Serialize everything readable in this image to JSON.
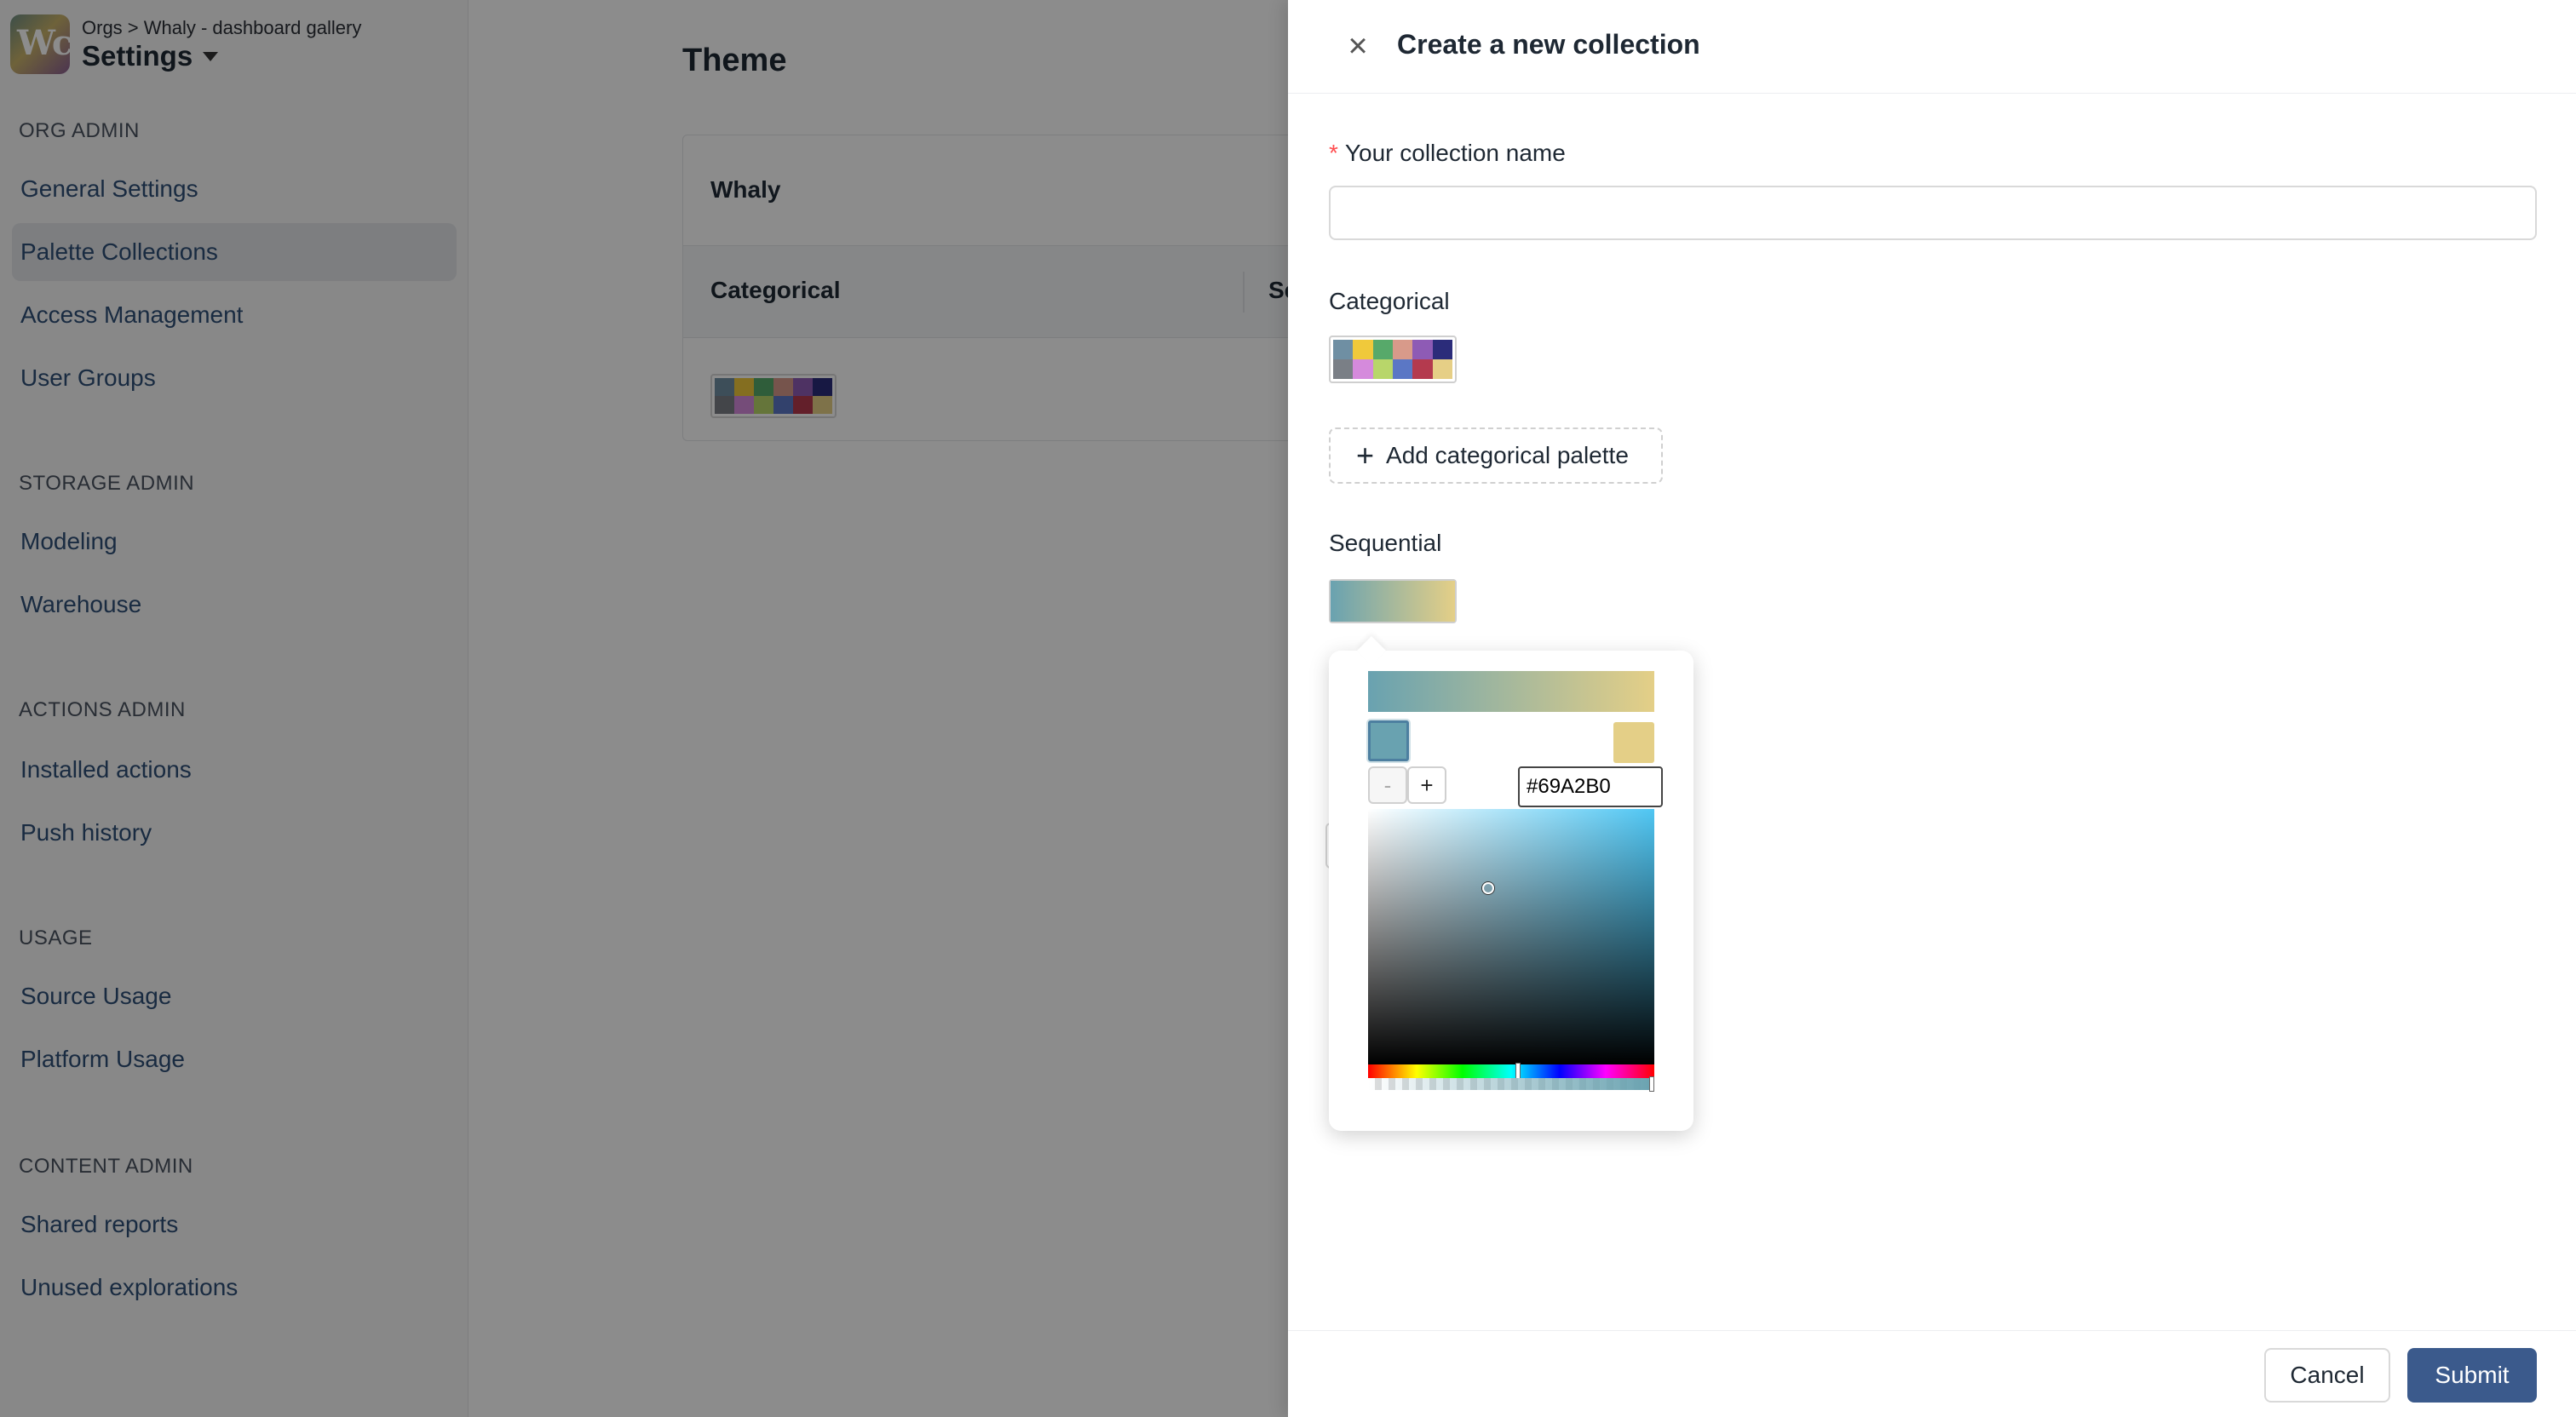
{
  "sidebar": {
    "breadcrumb": "Orgs > Whaly - dashboard gallery",
    "title": "Settings",
    "sections": [
      {
        "label": "ORG ADMIN",
        "items": [
          "General Settings",
          "Palette Collections",
          "Access Management",
          "User Groups"
        ]
      },
      {
        "label": "STORAGE ADMIN",
        "items": [
          "Modeling",
          "Warehouse"
        ]
      },
      {
        "label": "ACTIONS ADMIN",
        "items": [
          "Installed actions",
          "Push history"
        ]
      },
      {
        "label": "USAGE",
        "items": [
          "Source Usage",
          "Platform Usage"
        ]
      },
      {
        "label": "CONTENT ADMIN",
        "items": [
          "Shared reports",
          "Unused explorations"
        ]
      }
    ],
    "active_item": "Palette Collections"
  },
  "main": {
    "page_title": "Theme",
    "card_title": "Whaly",
    "columns": [
      "Categorical",
      "Se"
    ]
  },
  "drawer": {
    "title": "Create a new collection",
    "name_label": "Your collection name",
    "name_value": "",
    "categorical_label": "Categorical",
    "add_categorical_label": "Add categorical palette",
    "sequential_label": "Sequential",
    "cancel_label": "Cancel",
    "submit_label": "Submit"
  },
  "palette": {
    "categorical_colors": [
      "#6f8fa3",
      "#f0c93b",
      "#57a96a",
      "#d89a8a",
      "#8e5bb5",
      "#2b2c7a",
      "#7a7f86",
      "#d58adc",
      "#b8d66a",
      "#5b77c5",
      "#b43a4e",
      "#e6cf86"
    ],
    "sequential_start": "#69A2B0",
    "sequential_end": "#E4CF87"
  },
  "color_picker": {
    "hex_value": "#69A2B0",
    "minus_label": "-",
    "plus_label": "+",
    "hue_deg": 194,
    "alpha": 1.0
  }
}
